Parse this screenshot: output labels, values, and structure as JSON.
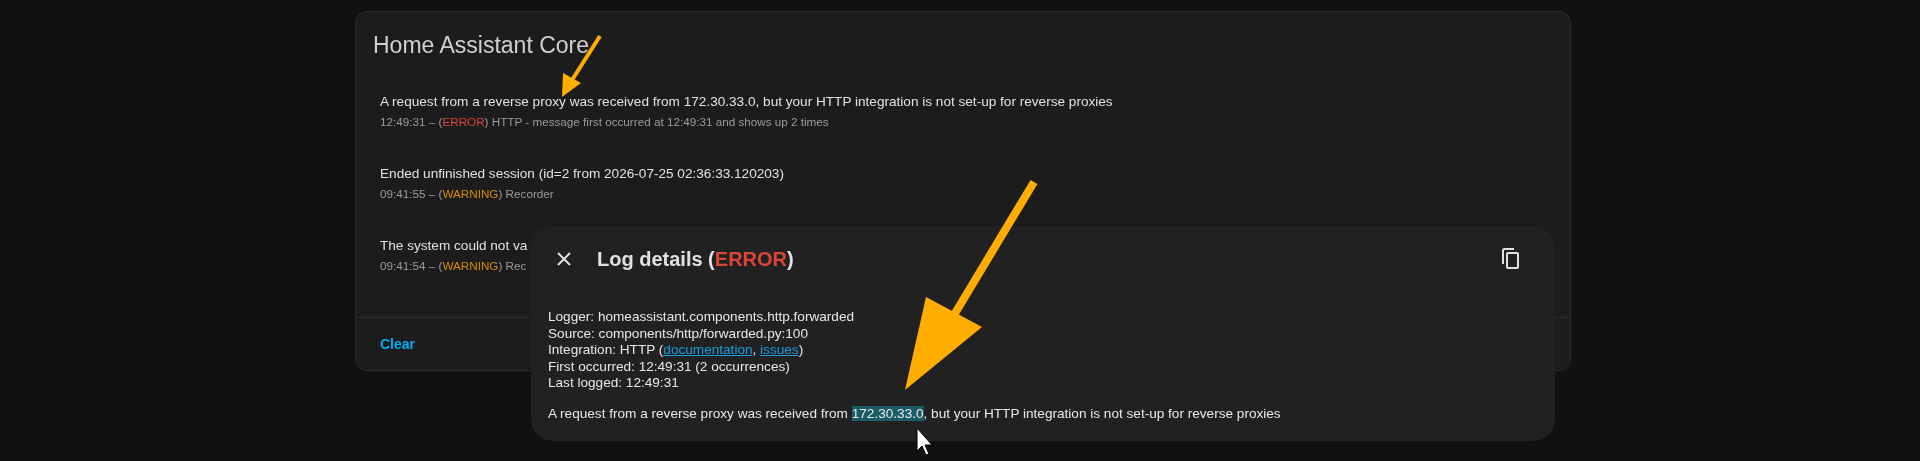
{
  "card": {
    "title": "Home Assistant Core",
    "entries": [
      {
        "message": "A request from a reverse proxy was received from 172.30.33.0, but your HTTP integration is not set-up for reverse proxies",
        "prefix": "12:49:31 – (",
        "level": "ERROR",
        "color": "#db4437",
        "suffix": ") HTTP - message first occurred at 12:49:31 and shows up 2 times"
      },
      {
        "message": "Ended unfinished session (id=2 from 2026-07-25 02:36:33.120203)",
        "prefix": "09:41:55 – (",
        "level": "WARNING",
        "color": "#d98c00",
        "suffix": ") Recorder"
      },
      {
        "message": "The system could not va",
        "prefix": "09:41:54 – (",
        "level": "WARNING",
        "color": "#d98c00",
        "suffix": ") Rec"
      }
    ],
    "footer_button": "Clear"
  },
  "dialog": {
    "title": "Log details (",
    "level": "ERROR",
    "color": "#db4437",
    "title_end": ")",
    "lines": [
      {
        "kind": "text",
        "text": "Logger: homeassistant.components.http.forwarded"
      },
      {
        "kind": "text",
        "text": "Source: components/http/forwarded.py:100"
      },
      {
        "kind": "links",
        "before": "Integration: HTTP (",
        "link1": "documentation",
        "between": ", ",
        "link2": "issues",
        "after": ")"
      },
      {
        "kind": "text",
        "text": "First occurred: 12:49:31 (2 occurrences)"
      },
      {
        "kind": "text",
        "text": "Last logged: 12:49:31"
      }
    ],
    "message": {
      "before": "A request from a reverse proxy was received from ",
      "selected_text": "172.30.33.0",
      "after": ", but your HTTP integration is not set-up for reverse proxies"
    }
  }
}
